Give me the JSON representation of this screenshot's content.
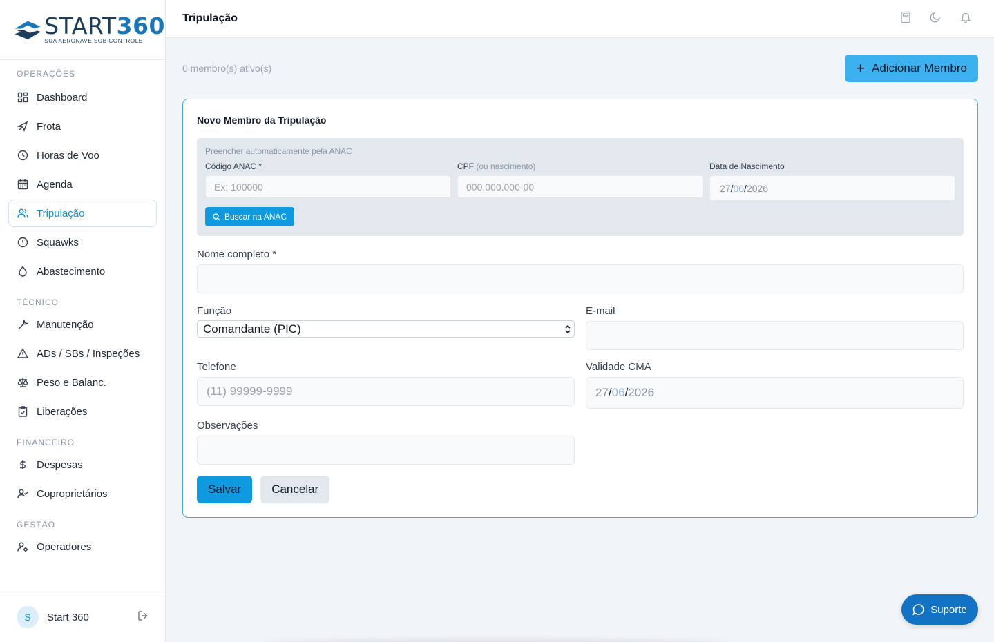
{
  "brand": {
    "name_part1": "START",
    "name_part2": "360",
    "tagline": "SUA AERONAVE SOB CONTROLE",
    "color_dark": "#1c3e5c",
    "color_accent": "#1876b9"
  },
  "sidebar": {
    "sections": [
      {
        "title": "OPERAÇÕES",
        "items": [
          {
            "label": "Dashboard",
            "icon": "grid-icon"
          },
          {
            "label": "Frota",
            "icon": "plane-icon"
          },
          {
            "label": "Horas de Voo",
            "icon": "clock-icon"
          },
          {
            "label": "Agenda",
            "icon": "calendar-icon"
          },
          {
            "label": "Tripulação",
            "icon": "users-icon",
            "active": true
          },
          {
            "label": "Squawks",
            "icon": "alert-circle-icon"
          },
          {
            "label": "Abastecimento",
            "icon": "droplet-icon"
          }
        ]
      },
      {
        "title": "TÉCNICO",
        "items": [
          {
            "label": "Manutenção",
            "icon": "wrench-icon"
          },
          {
            "label": "ADs / SBs / Inspeções",
            "icon": "warning-triangle-icon"
          },
          {
            "label": "Peso e Balanc.",
            "icon": "scale-icon"
          },
          {
            "label": "Liberações",
            "icon": "clipboard-check-icon"
          }
        ]
      },
      {
        "title": "FINANCEIRO",
        "items": [
          {
            "label": "Despesas",
            "icon": "dollar-icon"
          },
          {
            "label": "Coproprietários",
            "icon": "user-check-icon"
          }
        ]
      },
      {
        "title": "GESTÃO",
        "items": [
          {
            "label": "Operadores",
            "icon": "user-cog-icon"
          }
        ]
      }
    ],
    "user": {
      "initial": "S",
      "name": "Start 360"
    }
  },
  "header": {
    "title": "Tripulação",
    "icons": [
      "calculator-icon",
      "moon-icon",
      "bell-icon"
    ]
  },
  "main": {
    "active_count_text": "0 membro(s) ativo(s)",
    "add_button_label": "Adicionar Membro",
    "form": {
      "title": "Novo Membro da Tripulação",
      "anac": {
        "hint": "Preencher automaticamente pela ANAC",
        "codigo_label": "Código ANAC *",
        "codigo_placeholder": "Ex: 100000",
        "cpf_label": "CPF",
        "cpf_label_muted": "(ou nascimento)",
        "cpf_placeholder": "000.000.000-00",
        "nascimento_label": "Data de Nascimento",
        "nascimento_value": {
          "day": "27",
          "month": "06",
          "year": "2026"
        },
        "search_button_label": "Buscar na ANAC"
      },
      "nome_label": "Nome completo *",
      "nome_value": "",
      "funcao_label": "Função",
      "funcao_value": "Comandante (PIC)",
      "email_label": "E-mail",
      "email_value": "",
      "telefone_label": "Telefone",
      "telefone_placeholder": "(11) 99999-9999",
      "cma_label": "Validade CMA",
      "cma_value": {
        "day": "27",
        "month": "06",
        "year": "2026"
      },
      "obs_label": "Observações",
      "obs_value": "",
      "save_label": "Salvar",
      "cancel_label": "Cancelar"
    }
  },
  "support_label": "Suporte",
  "colors": {
    "accent": "#3bb2ef",
    "primary": "#0f9ae0",
    "support": "#1273c4"
  }
}
